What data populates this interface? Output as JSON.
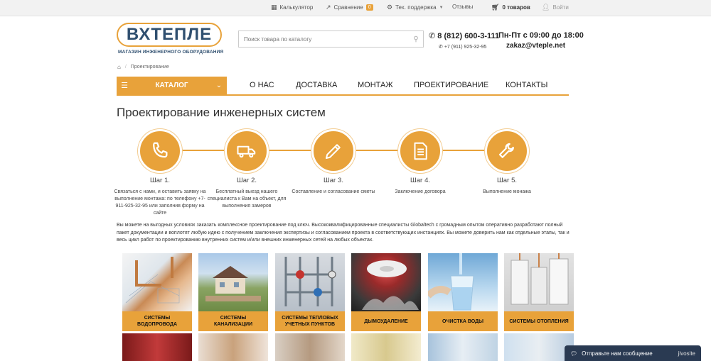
{
  "topbar": {
    "calculator": "Калькулятор",
    "compare": "Сравнение",
    "compare_count": "0",
    "support": "Тех. поддержка",
    "reviews": "Отзывы",
    "cart": "0 товаров",
    "login": "Войти"
  },
  "header": {
    "logo_text": "ВХТЕПЛЕ",
    "logo_sub": "МАГАЗИН ИНЖЕНЕРНОГО ОБОРУДОВАНИЯ",
    "search_placeholder": "Поиск товара по каталогу",
    "phone_main": "8 (812) 600-3-111",
    "phone_sub": "+7 (911) 925-32-95",
    "hours": "Пн-Пт с 09:00 до 18:00",
    "email": "zakaz@vteple.net"
  },
  "breadcrumb": {
    "current": "Проектирование"
  },
  "nav": {
    "catalog": "КАТАЛОГ",
    "links": [
      "О НАС",
      "ДОСТАВКА",
      "МОНТАЖ",
      "ПРОЕКТИРОВАНИЕ",
      "КОНТАКТЫ"
    ]
  },
  "page_title": "Проектирование инженерных систем",
  "steps": [
    {
      "title": "Шаг 1.",
      "desc": "Связаться с нами, и оставить заявку на выполнение монтажа: по телефону +7-911-925-32-95 или заполнив форму на сайте",
      "icon": "phone-icon"
    },
    {
      "title": "Шаг 2.",
      "desc": "Бесплатный выезд нашего специалиста к Вам на объект, для выполнения замеров",
      "icon": "truck-icon"
    },
    {
      "title": "Шаг 3.",
      "desc": "Составление и согласование сметы",
      "icon": "pencil-icon"
    },
    {
      "title": "Шаг 4.",
      "desc": "Заключение договора",
      "icon": "document-icon"
    },
    {
      "title": "Шаг 5.",
      "desc": "Выполнение монажа",
      "icon": "wrench-icon"
    }
  ],
  "description": "Вы можете на выгодных условиях заказать комплексное проектирование под ключ. Высококвалифицированные специалисты Globaltech с громадным опытом оперативно разработают полный пакет документации и воплотят любую идею с получением заключения экспертизы и согласованием проекта в соответствующих инстанциях. Вы можете доверить нам как отдельные этапы, так и весь цикл работ по проектированию внутренних систем и/или внешних инженерных сетей на любых объектах.",
  "categories": [
    "СИСТЕМЫ ВОДОПРОВОДА",
    "СИСТЕМЫ КАНАЛИЗАЦИИ",
    "СИСТЕМЫ ТЕПЛОВЫХ УЧЕТНЫХ ПУНКТОВ",
    "ДЫМОУДАЛЕНИЕ",
    "ОЧИСТКА ВОДЫ",
    "СИСТЕМЫ ОТОПЛЕНИЯ"
  ],
  "chat": {
    "label": "Отправьте нам сообщение",
    "brand": "jivosite"
  },
  "colors": {
    "accent": "#e8a23a",
    "chat_bg": "#2a3a52"
  }
}
